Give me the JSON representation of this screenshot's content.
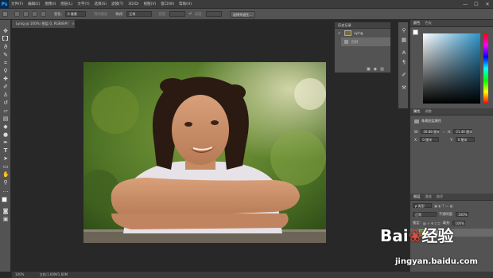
{
  "app": {
    "logo": "Ps"
  },
  "menubar": {
    "items": [
      "文件(F)",
      "编辑(E)",
      "图像(I)",
      "图层(L)",
      "文字(Y)",
      "选择(S)",
      "滤镜(T)",
      "3D(D)",
      "视图(V)",
      "窗口(W)",
      "帮助(H)"
    ],
    "min": "—",
    "max": "☐",
    "close": "✕"
  },
  "options": {
    "feather_label": "羽化:",
    "feather_value": "0 像素",
    "antialias": "消除锯齿",
    "style_label": "样式:",
    "style_value": "正常",
    "width_label": "宽度:",
    "height_label": "高度:",
    "refine_button": "选择并遮住..."
  },
  "document": {
    "tab_title": "Lying @ 100% (图层 0, RGB/8#)"
  },
  "status": {
    "zoom": "100%",
    "doc_info": "文档:1.60M/1.60M"
  },
  "history_panel": {
    "title": "历史记录",
    "rows": [
      {
        "label": "Lying",
        "is_snapshot": true
      },
      {
        "label": "打开",
        "is_snapshot": false
      }
    ]
  },
  "color_panel": {
    "tabs": [
      "颜色",
      "色板"
    ],
    "foreground": "#ffffff",
    "background": "#000000"
  },
  "properties_panel": {
    "tabs": [
      "属性",
      "调整"
    ],
    "subtitle": "像素图层属性",
    "w_label": "W:",
    "w_value": "26.88 厘米",
    "h_label": "H:",
    "h_value": "21.46 厘米",
    "x_label": "X:",
    "x_value": "0 厘米",
    "y_label": "Y:",
    "y_value": "0 厘米"
  },
  "layers_panel": {
    "tabs": [
      "图层",
      "通道",
      "路径"
    ],
    "kind_label": "ρ 类型",
    "blend_mode": "正常",
    "opacity_label": "不透明度:",
    "opacity_value": "100%",
    "lock_label": "锁定:",
    "fill_label": "填充:",
    "fill_value": "100%",
    "layer_name": "图层 0"
  },
  "watermark": {
    "brand": "Bai",
    "brand_tail": "经验",
    "url": "jingyan.baidu.com"
  }
}
